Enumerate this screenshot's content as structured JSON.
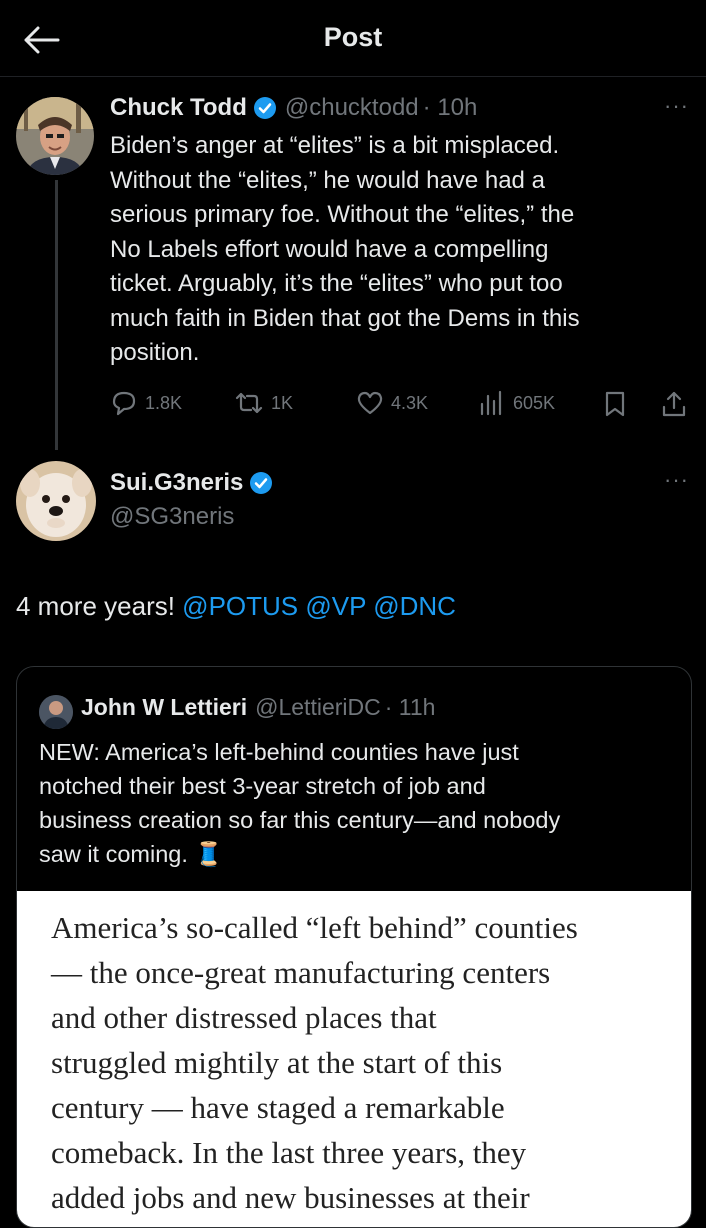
{
  "header": {
    "title": "Post",
    "back_icon": "arrow-left-icon"
  },
  "tweet": {
    "author": "Chuck Todd",
    "handle": "@chucktodd",
    "time": "· 10h",
    "lines": [
      "Biden’s anger at “elites” is a bit misplaced.",
      "Without the “elites,” he would have had a",
      "serious primary foe. Without the “elites,” the",
      "No Labels effort would have a compelling",
      "ticket. Arguably, it’s the “elites” who put too",
      "much faith in Biden that got the Dems in this",
      "position."
    ],
    "stats": {
      "replies": "1.8K",
      "reposts": "1K",
      "likes": "4.3K",
      "views": "605K"
    }
  },
  "reply": {
    "author": "Sui.G3neris",
    "handle": "@SG3neris",
    "text_prefix": "4 more years! ",
    "mentions": [
      "@POTUS",
      "@VP",
      "@DNC"
    ]
  },
  "quote": {
    "author": "John W Lettieri",
    "handle": "@LettieriDC",
    "time": "· 11h",
    "lines": [
      "NEW: America’s left-behind counties have just",
      "notched their best 3-year stretch of job and",
      "business creation so far this century—and nobody",
      "saw it coming."
    ],
    "emoji": "🧵",
    "article_lines": [
      "America’s so-called “left behind” counties",
      "— the once-great manufacturing centers",
      "and other distressed places that",
      "struggled mightily at the start of this",
      "century — have staged a remarkable",
      "comeback. In the last three years, they",
      "added jobs and new businesses at their"
    ]
  },
  "colors": {
    "accent": "#1d9bf0",
    "muted": "#71767b",
    "background": "#000000",
    "text": "#e7e9ea"
  }
}
